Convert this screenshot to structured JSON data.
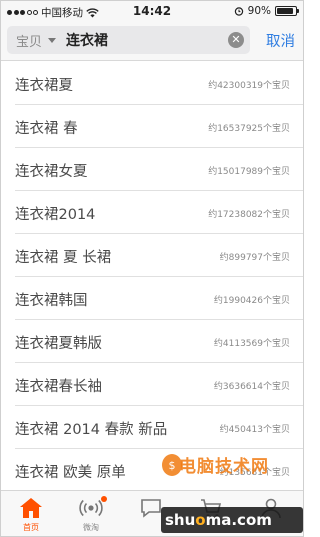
{
  "status_bar": {
    "carrier": "中国移动",
    "time": "14:42",
    "battery": "90%",
    "battery_level": 0.9
  },
  "search": {
    "scope_label": "宝贝",
    "query": "连衣裙",
    "clear_icon": "clear-icon",
    "cancel_label": "取消"
  },
  "suggestions": [
    {
      "term": "连衣裙夏",
      "count": "约42300319个宝贝"
    },
    {
      "term": "连衣裙 春",
      "count": "约16537925个宝贝"
    },
    {
      "term": "连衣裙女夏",
      "count": "约15017989个宝贝"
    },
    {
      "term": "连衣裙2014",
      "count": "约17238082个宝贝"
    },
    {
      "term": "连衣裙 夏 长裙",
      "count": "约899797个宝贝"
    },
    {
      "term": "连衣裙韩国",
      "count": "约1990426个宝贝"
    },
    {
      "term": "连衣裙夏韩版",
      "count": "约4113569个宝贝"
    },
    {
      "term": "连衣裙春长袖",
      "count": "约3636614个宝贝"
    },
    {
      "term": "连衣裙 2014 春款 新品",
      "count": "约450413个宝贝"
    },
    {
      "term": "连衣裙 欧美 原单",
      "count": "约135681个宝贝"
    }
  ],
  "tabs": [
    {
      "label": "首页",
      "icon": "home-icon",
      "active": true
    },
    {
      "label": "微淘",
      "icon": "broadcast-icon",
      "active": false
    },
    {
      "label": "",
      "icon": "chat-icon",
      "active": false
    },
    {
      "label": "",
      "icon": "cart-icon",
      "active": false
    },
    {
      "label": "",
      "icon": "user-icon",
      "active": false
    }
  ],
  "watermark": {
    "top": "电脑技术网",
    "bottom_prefix": "shu",
    "bottom_mid": "o",
    "bottom_suffix": "ma.com"
  },
  "colors": {
    "accent": "#ff5000",
    "link": "#2f7de1"
  }
}
